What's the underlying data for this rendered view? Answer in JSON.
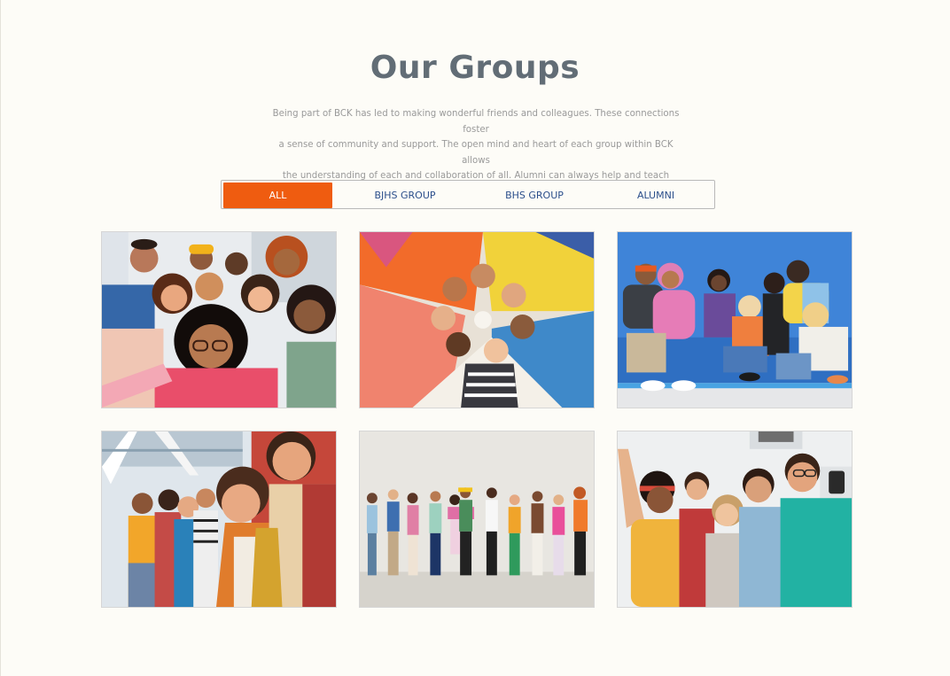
{
  "section": {
    "title": "Our Groups",
    "intro_lines": [
      "Being part of BCK has led to making wonderful friends and colleagues. These connections foster",
      "a sense of community and support. The open mind and heart of each group within BCK allows",
      "the understanding of each and collaboration of all. Alumni can always help and teach others!"
    ]
  },
  "filters": {
    "active_index": 0,
    "items": [
      {
        "label": "ALL"
      },
      {
        "label": "BJHS GROUP"
      },
      {
        "label": "BHS GROUP"
      },
      {
        "label": "ALUMNI"
      }
    ]
  },
  "colors": {
    "accent": "#ef5c10",
    "title": "#626d76",
    "tab_text": "#2c4f8c",
    "background": "#fdfcf7"
  },
  "gallery": {
    "photos": [
      {
        "subject": "group-selfie-photo"
      },
      {
        "subject": "circle-huddle-photo"
      },
      {
        "subject": "sitting-on-ledge-photo"
      },
      {
        "subject": "laughing-group-photo"
      },
      {
        "subject": "wall-lineup-photo"
      },
      {
        "subject": "friends-selfie-photo"
      }
    ]
  }
}
